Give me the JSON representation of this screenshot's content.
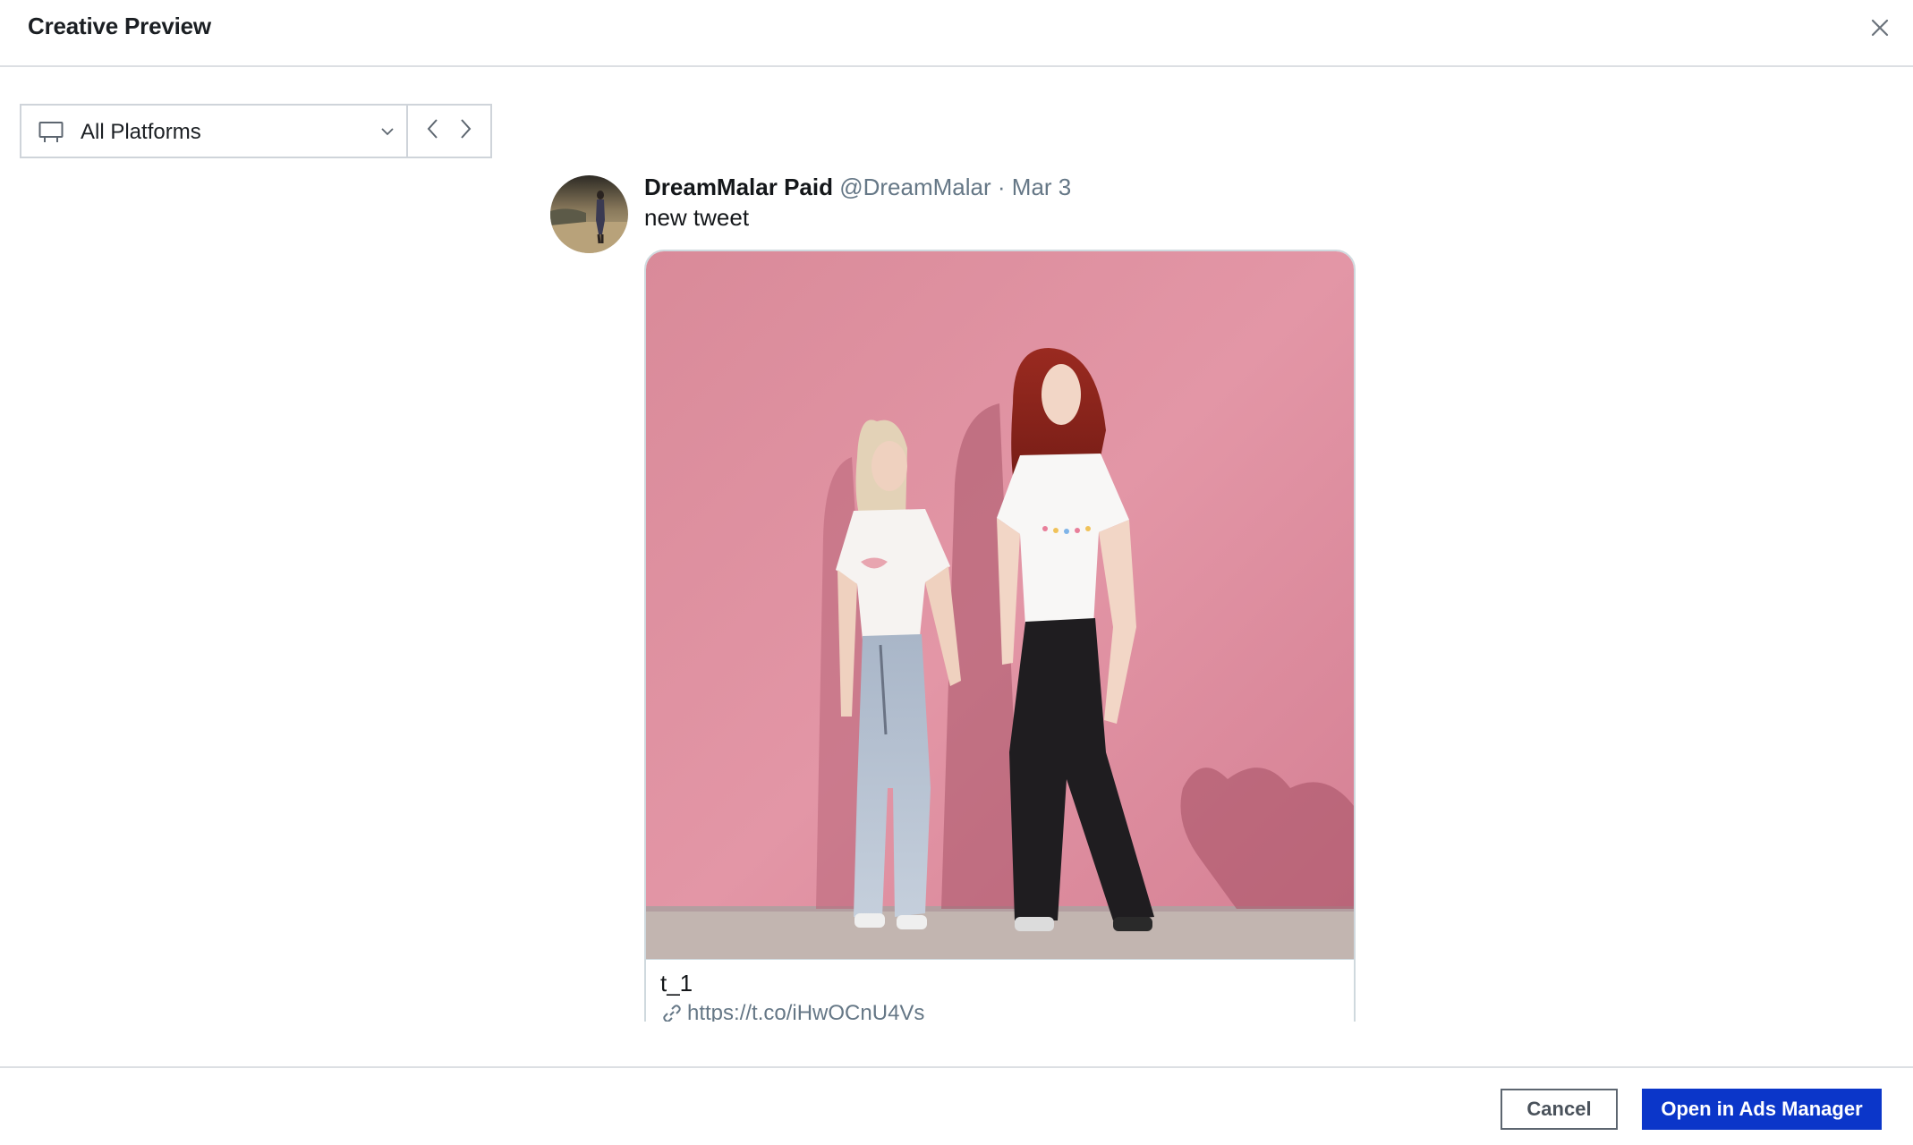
{
  "modal": {
    "title": "Creative Preview",
    "close_icon": "close-icon"
  },
  "toolbar": {
    "platform_icon": "monitor-icon",
    "platform_value": "All Platforms",
    "dropdown_icon": "chevron-down-icon",
    "prev_icon": "chevron-left-icon",
    "next_icon": "chevron-right-icon"
  },
  "tweet": {
    "display_name": "DreamMalar Paid",
    "handle": "@DreamMalar",
    "separator": "·",
    "date": "Mar 3",
    "text": "new tweet",
    "card": {
      "title": "t_1",
      "link_icon": "link-icon",
      "url": "https://t.co/iHwOCnU4Vs"
    }
  },
  "footer": {
    "cancel_label": "Cancel",
    "primary_label": "Open in Ads Manager"
  },
  "colors": {
    "primary": "#0b36c9",
    "handle_gray": "#657786",
    "wall_pink": "#dc8e9d"
  }
}
